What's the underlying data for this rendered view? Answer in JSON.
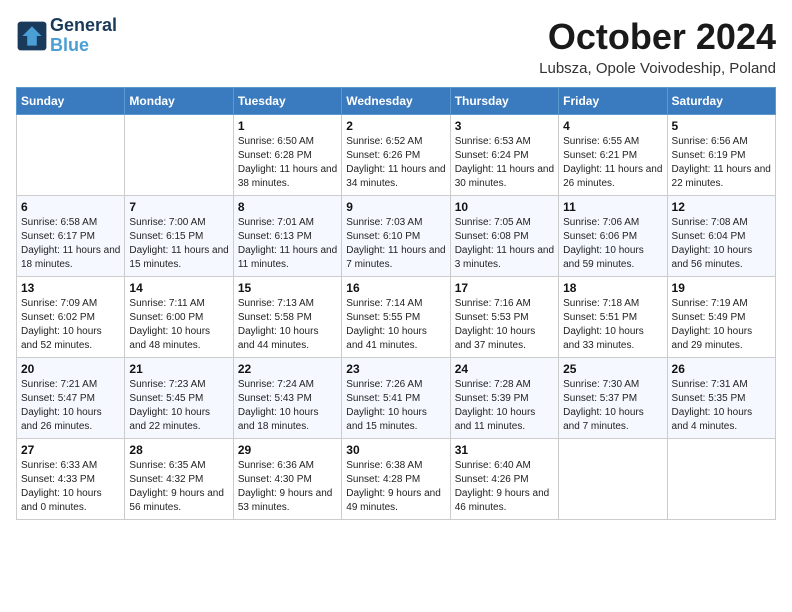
{
  "header": {
    "logo_line1": "General",
    "logo_line2": "Blue",
    "month": "October 2024",
    "location": "Lubsza, Opole Voivodeship, Poland"
  },
  "weekdays": [
    "Sunday",
    "Monday",
    "Tuesday",
    "Wednesday",
    "Thursday",
    "Friday",
    "Saturday"
  ],
  "weeks": [
    [
      {
        "day": "",
        "info": ""
      },
      {
        "day": "",
        "info": ""
      },
      {
        "day": "1",
        "info": "Sunrise: 6:50 AM\nSunset: 6:28 PM\nDaylight: 11 hours and 38 minutes."
      },
      {
        "day": "2",
        "info": "Sunrise: 6:52 AM\nSunset: 6:26 PM\nDaylight: 11 hours and 34 minutes."
      },
      {
        "day": "3",
        "info": "Sunrise: 6:53 AM\nSunset: 6:24 PM\nDaylight: 11 hours and 30 minutes."
      },
      {
        "day": "4",
        "info": "Sunrise: 6:55 AM\nSunset: 6:21 PM\nDaylight: 11 hours and 26 minutes."
      },
      {
        "day": "5",
        "info": "Sunrise: 6:56 AM\nSunset: 6:19 PM\nDaylight: 11 hours and 22 minutes."
      }
    ],
    [
      {
        "day": "6",
        "info": "Sunrise: 6:58 AM\nSunset: 6:17 PM\nDaylight: 11 hours and 18 minutes."
      },
      {
        "day": "7",
        "info": "Sunrise: 7:00 AM\nSunset: 6:15 PM\nDaylight: 11 hours and 15 minutes."
      },
      {
        "day": "8",
        "info": "Sunrise: 7:01 AM\nSunset: 6:13 PM\nDaylight: 11 hours and 11 minutes."
      },
      {
        "day": "9",
        "info": "Sunrise: 7:03 AM\nSunset: 6:10 PM\nDaylight: 11 hours and 7 minutes."
      },
      {
        "day": "10",
        "info": "Sunrise: 7:05 AM\nSunset: 6:08 PM\nDaylight: 11 hours and 3 minutes."
      },
      {
        "day": "11",
        "info": "Sunrise: 7:06 AM\nSunset: 6:06 PM\nDaylight: 10 hours and 59 minutes."
      },
      {
        "day": "12",
        "info": "Sunrise: 7:08 AM\nSunset: 6:04 PM\nDaylight: 10 hours and 56 minutes."
      }
    ],
    [
      {
        "day": "13",
        "info": "Sunrise: 7:09 AM\nSunset: 6:02 PM\nDaylight: 10 hours and 52 minutes."
      },
      {
        "day": "14",
        "info": "Sunrise: 7:11 AM\nSunset: 6:00 PM\nDaylight: 10 hours and 48 minutes."
      },
      {
        "day": "15",
        "info": "Sunrise: 7:13 AM\nSunset: 5:58 PM\nDaylight: 10 hours and 44 minutes."
      },
      {
        "day": "16",
        "info": "Sunrise: 7:14 AM\nSunset: 5:55 PM\nDaylight: 10 hours and 41 minutes."
      },
      {
        "day": "17",
        "info": "Sunrise: 7:16 AM\nSunset: 5:53 PM\nDaylight: 10 hours and 37 minutes."
      },
      {
        "day": "18",
        "info": "Sunrise: 7:18 AM\nSunset: 5:51 PM\nDaylight: 10 hours and 33 minutes."
      },
      {
        "day": "19",
        "info": "Sunrise: 7:19 AM\nSunset: 5:49 PM\nDaylight: 10 hours and 29 minutes."
      }
    ],
    [
      {
        "day": "20",
        "info": "Sunrise: 7:21 AM\nSunset: 5:47 PM\nDaylight: 10 hours and 26 minutes."
      },
      {
        "day": "21",
        "info": "Sunrise: 7:23 AM\nSunset: 5:45 PM\nDaylight: 10 hours and 22 minutes."
      },
      {
        "day": "22",
        "info": "Sunrise: 7:24 AM\nSunset: 5:43 PM\nDaylight: 10 hours and 18 minutes."
      },
      {
        "day": "23",
        "info": "Sunrise: 7:26 AM\nSunset: 5:41 PM\nDaylight: 10 hours and 15 minutes."
      },
      {
        "day": "24",
        "info": "Sunrise: 7:28 AM\nSunset: 5:39 PM\nDaylight: 10 hours and 11 minutes."
      },
      {
        "day": "25",
        "info": "Sunrise: 7:30 AM\nSunset: 5:37 PM\nDaylight: 10 hours and 7 minutes."
      },
      {
        "day": "26",
        "info": "Sunrise: 7:31 AM\nSunset: 5:35 PM\nDaylight: 10 hours and 4 minutes."
      }
    ],
    [
      {
        "day": "27",
        "info": "Sunrise: 6:33 AM\nSunset: 4:33 PM\nDaylight: 10 hours and 0 minutes."
      },
      {
        "day": "28",
        "info": "Sunrise: 6:35 AM\nSunset: 4:32 PM\nDaylight: 9 hours and 56 minutes."
      },
      {
        "day": "29",
        "info": "Sunrise: 6:36 AM\nSunset: 4:30 PM\nDaylight: 9 hours and 53 minutes."
      },
      {
        "day": "30",
        "info": "Sunrise: 6:38 AM\nSunset: 4:28 PM\nDaylight: 9 hours and 49 minutes."
      },
      {
        "day": "31",
        "info": "Sunrise: 6:40 AM\nSunset: 4:26 PM\nDaylight: 9 hours and 46 minutes."
      },
      {
        "day": "",
        "info": ""
      },
      {
        "day": "",
        "info": ""
      }
    ]
  ]
}
